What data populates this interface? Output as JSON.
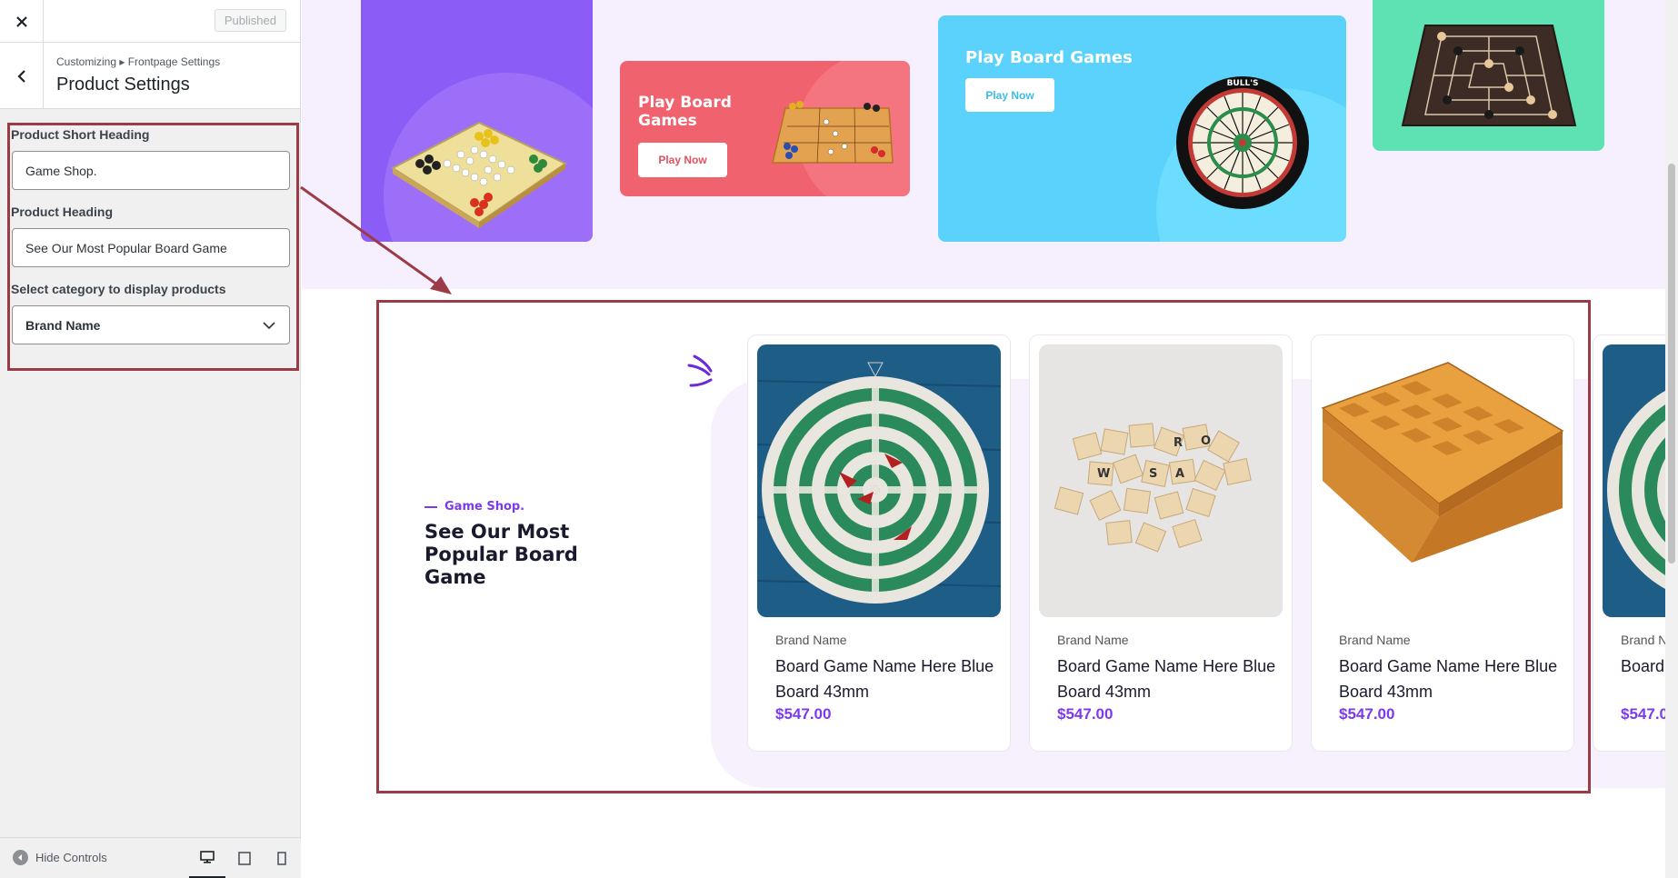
{
  "sidebar": {
    "close_icon": "close-icon",
    "published_label": "Published",
    "breadcrumb": "Customizing ▸ Frontpage Settings",
    "title": "Product Settings",
    "fields": {
      "short_heading_label": "Product Short Heading",
      "short_heading_value": "Game Shop.",
      "heading_label": "Product Heading",
      "heading_value": "See Our Most Popular Board Game",
      "category_label": "Select category to display products",
      "category_value": "Brand Name"
    },
    "footer": {
      "hide_controls": "Hide Controls",
      "devices": [
        "desktop-icon",
        "tablet-icon",
        "mobile-icon"
      ]
    }
  },
  "banners": {
    "red": {
      "title": "Play Board Games",
      "button": "Play Now"
    },
    "blue": {
      "title": "Play Board Games",
      "button": "Play Now"
    }
  },
  "section": {
    "tag": "Game Shop.",
    "heading": "See Our Most Popular Board Game"
  },
  "products": [
    {
      "brand": "Brand Name",
      "name": "Board Game Name Here Blue Board 43mm",
      "price": "$547.00"
    },
    {
      "brand": "Brand Name",
      "name": "Board Game Name Here Blue Board 43mm",
      "price": "$547.00"
    },
    {
      "brand": "Brand Name",
      "name": "Board Game Name Here Blue Board 43mm",
      "price": "$547.00"
    },
    {
      "brand": "Brand N",
      "name": "Board Blue B",
      "price": "$547.0"
    }
  ],
  "colors": {
    "accent": "#7c3aed",
    "highlight": "#9b3b48",
    "banner_red": "#f1626f",
    "banner_blue": "#5bd2fb",
    "banner_purple": "#8b5cf6",
    "banner_green": "#5ee2b4"
  }
}
